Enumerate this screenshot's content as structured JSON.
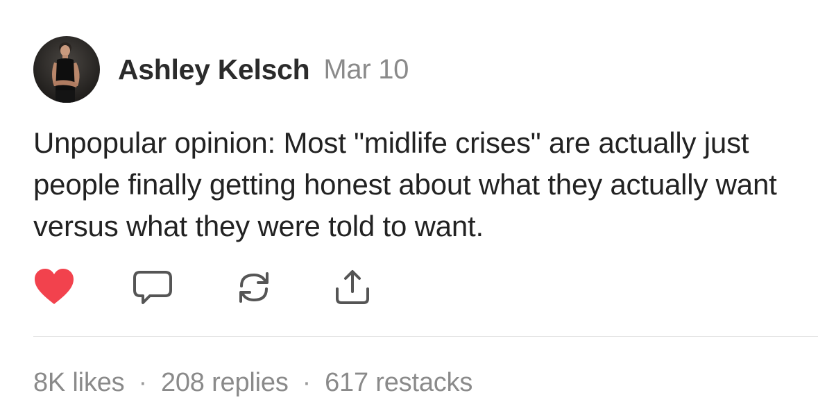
{
  "post": {
    "author": "Ashley Kelsch",
    "date": "Mar 10",
    "text": "Unpopular opinion: Most \"midlife crises\" are actually just people finally getting honest about what they actually want versus what they were told to want.",
    "actions": [
      {
        "name": "like",
        "icon": "heart-icon",
        "liked": true,
        "color": "#f2424d"
      },
      {
        "name": "reply",
        "icon": "comment-icon"
      },
      {
        "name": "restack",
        "icon": "restack-icon"
      },
      {
        "name": "share",
        "icon": "share-icon"
      }
    ],
    "stats": {
      "likes": "8K likes",
      "replies": "208 replies",
      "restacks": "617 restacks",
      "separator": "·"
    }
  },
  "colors": {
    "heart": "#f2424d",
    "muted": "#8a8a8a",
    "text": "#222222",
    "icon_stroke": "#555555"
  }
}
